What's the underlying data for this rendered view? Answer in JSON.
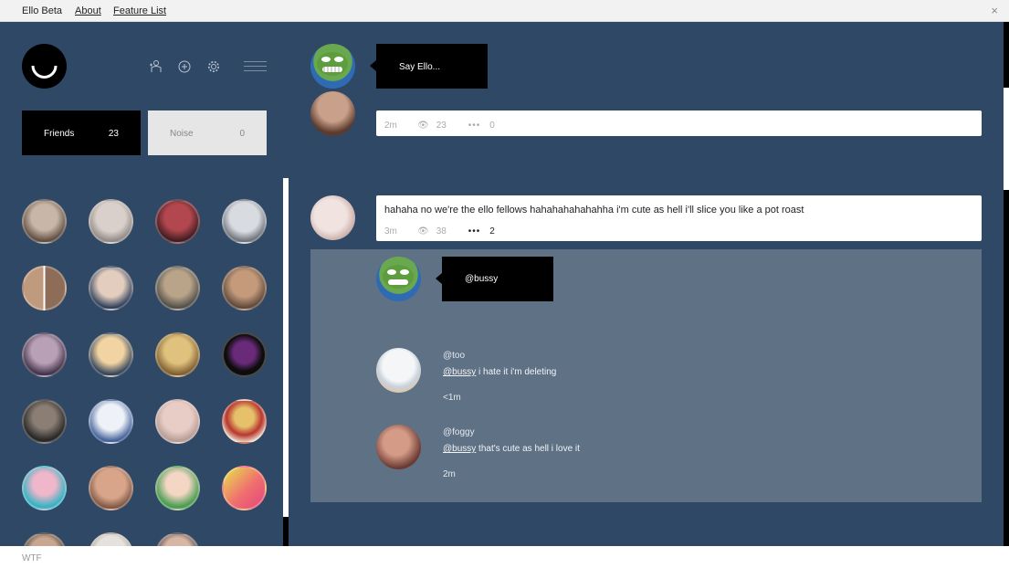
{
  "topbar": {
    "brand": "Ello Beta",
    "links": [
      "About",
      "Feature List"
    ],
    "close": "×"
  },
  "sidebar": {
    "logo_icon": "ello-smile-logo",
    "tools": [
      "invite-icon",
      "add-icon",
      "gear-icon",
      "menu-icon"
    ],
    "tabs": [
      {
        "label": "Friends",
        "count": "23"
      },
      {
        "label": "Noise",
        "count": "0"
      }
    ],
    "grid_count_visible": 23
  },
  "compose": {
    "prompt": "Say Ello..."
  },
  "posts": [
    {
      "text": "",
      "time": "2m",
      "views": "23",
      "comments": "0"
    },
    {
      "text": "hahaha no we're the ello fellows hahahahahahahha i'm cute as hell i'll slice you like a pot roast",
      "time": "3m",
      "views": "38",
      "comments": "2"
    }
  ],
  "comments_panel": {
    "reply_prompt": "@bussy",
    "comments": [
      {
        "author": "@too",
        "mention": "@bussy",
        "text": " i hate it i'm deleting",
        "time": "<1m"
      },
      {
        "author": "@foggy",
        "mention": "@bussy",
        "text": " that's cute as hell i love it",
        "time": "2m"
      }
    ]
  },
  "footer": {
    "text": "WTF"
  },
  "colors": {
    "background": "#2e4866",
    "comments_panel": "#5f7185",
    "tab_active": "#000000",
    "tab_inactive": "#e6e6e6"
  }
}
